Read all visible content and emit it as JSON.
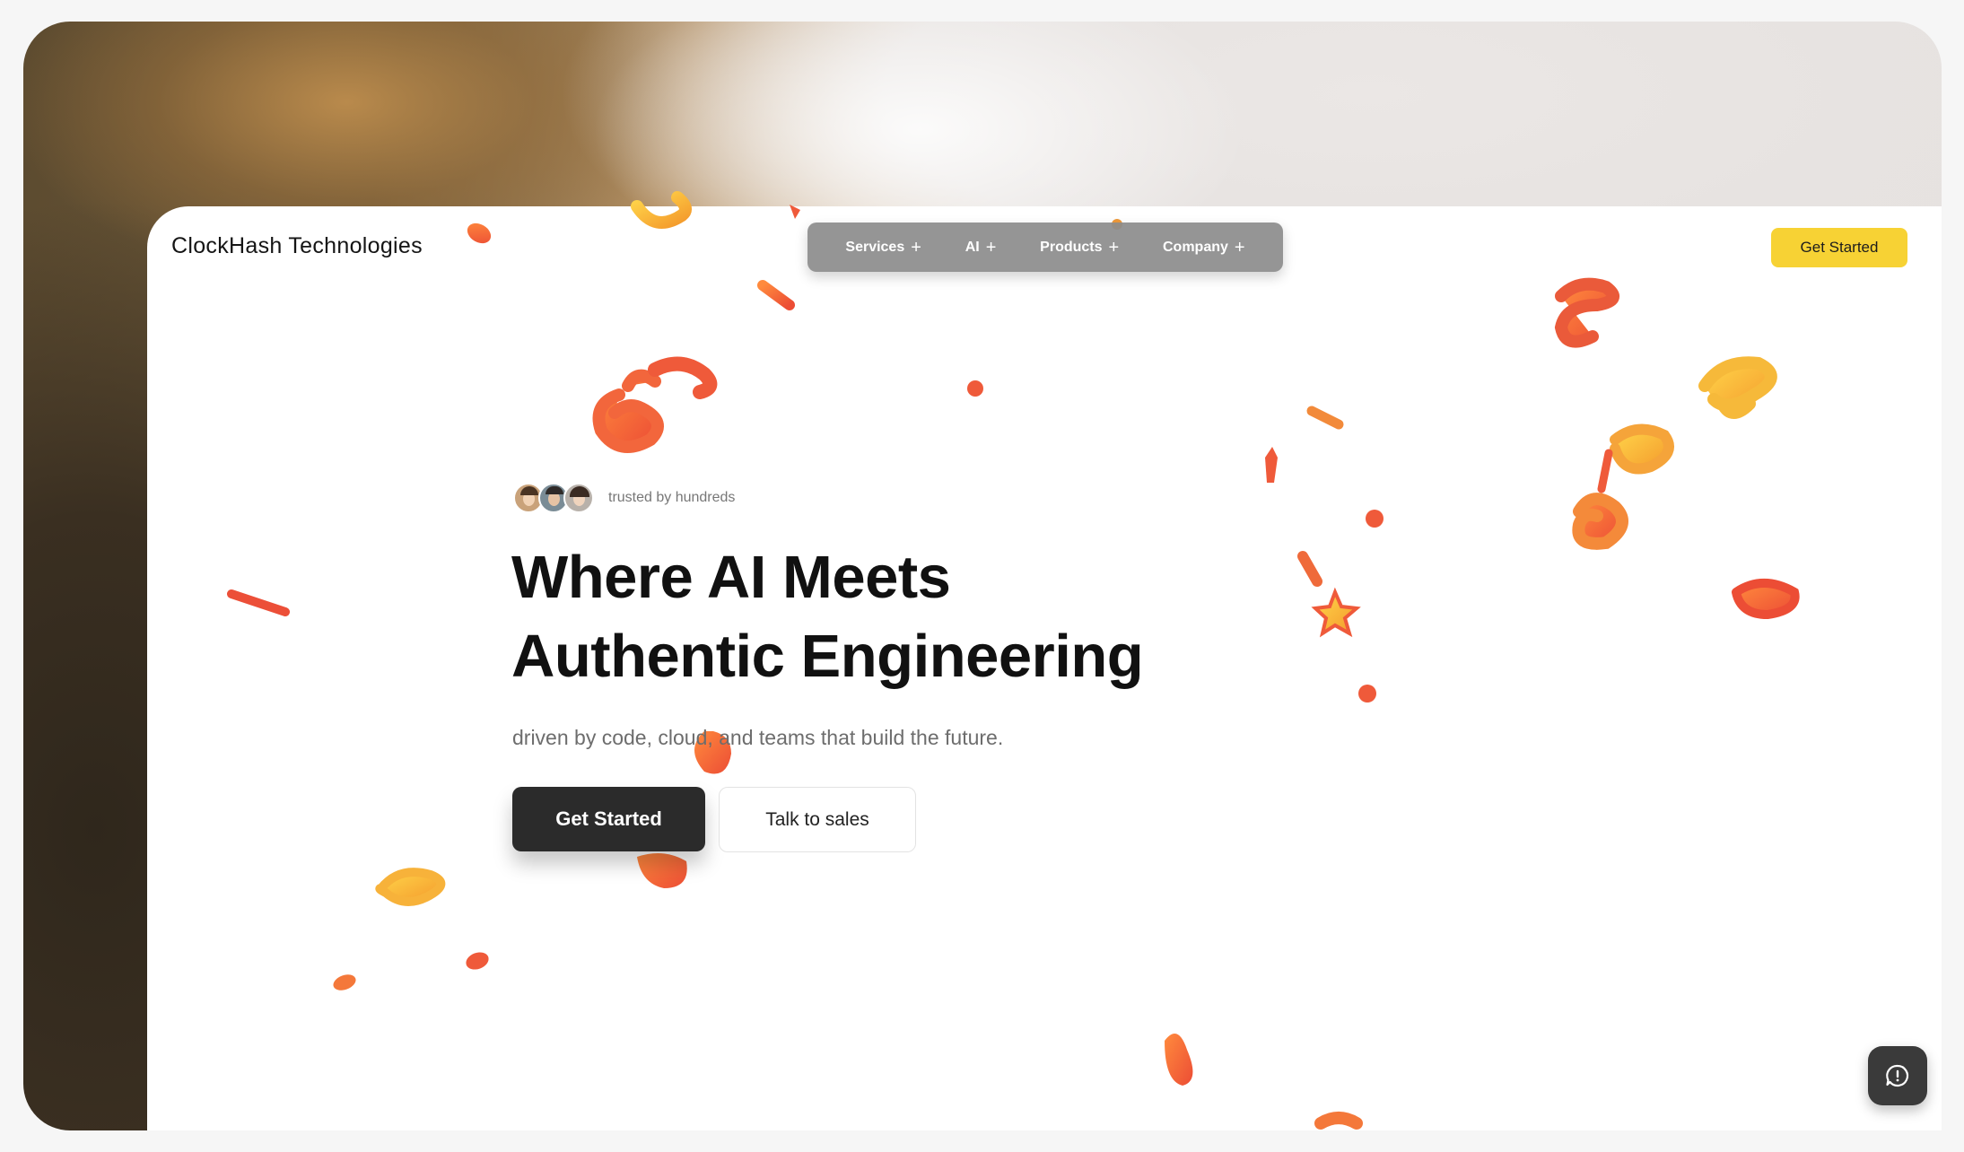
{
  "brand": {
    "name": "ClockHash Technologies"
  },
  "nav": {
    "items": [
      {
        "label": "Services"
      },
      {
        "label": "AI"
      },
      {
        "label": "Products"
      },
      {
        "label": "Company"
      }
    ],
    "expand_icon": "plus-icon"
  },
  "header": {
    "cta_label": "Get Started"
  },
  "hero": {
    "trust_text": "trusted by hundreds",
    "headline_line1": "Where AI Meets",
    "headline_line2": "Authentic Engineering",
    "subheadline": "driven by code, cloud, and teams that build the future.",
    "primary_cta": "Get Started",
    "secondary_cta": "Talk to sales"
  },
  "chat": {
    "icon": "chat-bubble-icon"
  },
  "colors": {
    "accent_yellow": "#f7d234",
    "dark_button": "#2b2b2b",
    "nav_bg": "#8c8c8c",
    "confetti_orange": "#f4663a",
    "confetti_yellow": "#f9b93a"
  }
}
